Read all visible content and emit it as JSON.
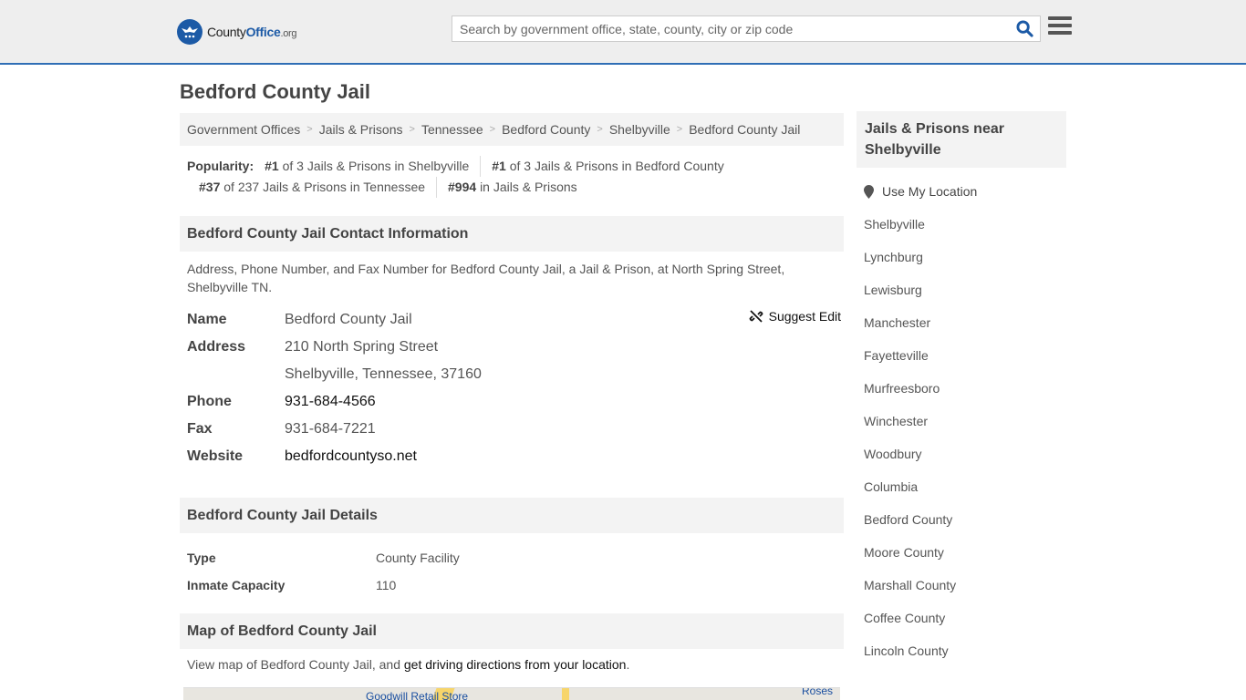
{
  "header": {
    "logo_county": "County",
    "logo_office": "Office",
    "logo_org": ".org",
    "search_placeholder": "Search by government office, state, county, city or zip code"
  },
  "page_title": "Bedford County Jail",
  "breadcrumb": [
    "Government Offices",
    "Jails & Prisons",
    "Tennessee",
    "Bedford County",
    "Shelbyville",
    "Bedford County Jail"
  ],
  "popularity": {
    "label": "Popularity:",
    "items": [
      {
        "rank": "#1",
        "text": "of 3 Jails & Prisons in Shelbyville"
      },
      {
        "rank": "#1",
        "text": "of 3 Jails & Prisons in Bedford County"
      },
      {
        "rank": "#37",
        "text": "of 237 Jails & Prisons in Tennessee"
      },
      {
        "rank": "#994",
        "text": "in Jails & Prisons"
      }
    ]
  },
  "contact": {
    "heading": "Bedford County Jail Contact Information",
    "description": "Address, Phone Number, and Fax Number for Bedford County Jail, a Jail & Prison, at North Spring Street, Shelbyville TN.",
    "suggest_edit": "Suggest Edit",
    "name_label": "Name",
    "name": "Bedford County Jail",
    "address_label": "Address",
    "address_line1": "210 North Spring Street",
    "address_line2": "Shelbyville, Tennessee, 37160",
    "phone_label": "Phone",
    "phone": "931-684-4566",
    "fax_label": "Fax",
    "fax": "931-684-7221",
    "website_label": "Website",
    "website": "bedfordcountyso.net"
  },
  "details": {
    "heading": "Bedford County Jail Details",
    "type_label": "Type",
    "type": "County Facility",
    "capacity_label": "Inmate Capacity",
    "capacity": "110"
  },
  "map": {
    "heading": "Map of Bedford County Jail",
    "desc_prefix": "View map of Bedford County Jail, and ",
    "desc_link": "get driving directions from your location",
    "desc_suffix": ".",
    "label_store": "Goodwill Retail Store",
    "label_roses": "Roses"
  },
  "sidebar": {
    "heading": "Jails & Prisons near Shelbyville",
    "use_location": "Use My Location",
    "items": [
      "Shelbyville",
      "Lynchburg",
      "Lewisburg",
      "Manchester",
      "Fayetteville",
      "Murfreesboro",
      "Winchester",
      "Woodbury",
      "Columbia",
      "Bedford County",
      "Moore County",
      "Marshall County",
      "Coffee County",
      "Lincoln County"
    ]
  }
}
